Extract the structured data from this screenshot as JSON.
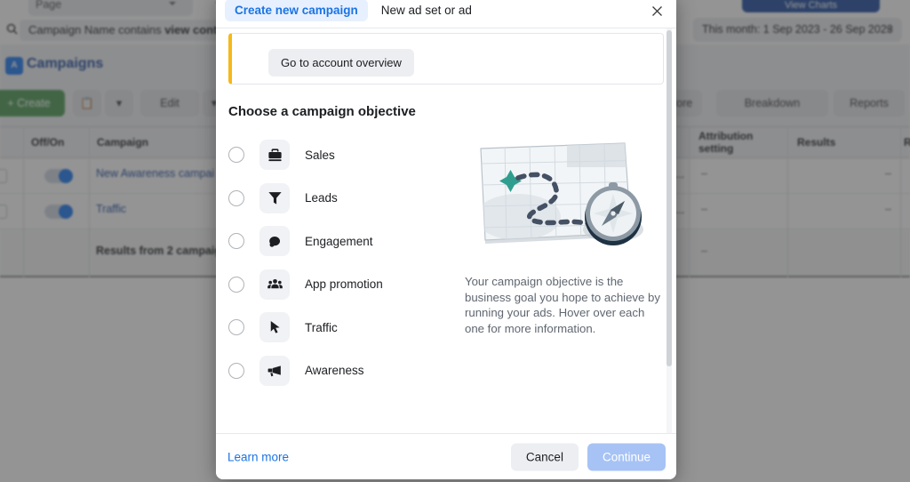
{
  "background": {
    "page_selector_label": "Page",
    "primary_button_label": "View Charts",
    "search": {
      "prefix": "Campaign Name contains ",
      "term": "view content"
    },
    "date_range": "This month: 1 Sep 2023 - 26 Sep 2023",
    "section_title": "Campaigns",
    "section_icon_letter": "A",
    "toolbar": {
      "create": "+  Create",
      "duplicate_icon": "duplicate-icon",
      "edit": "Edit",
      "more": "More",
      "breakdown": "Breakdown",
      "reports": "Reports"
    },
    "table": {
      "columns": [
        "Off/On",
        "Campaign",
        "Attribution setting",
        "Results",
        "R"
      ],
      "rows": [
        {
          "campaign": "New Awareness campai",
          "truncated": "l...",
          "attribution": "–",
          "results": "–",
          "toggle": "on"
        },
        {
          "campaign": "Traffic",
          "truncated": "l...",
          "attribution": "–",
          "results": "–",
          "toggle": "on"
        }
      ],
      "summary_label": "Results from 2 campaig",
      "summary_attribution": "–"
    }
  },
  "modal": {
    "tabs": [
      {
        "label": "Create new campaign",
        "active": true
      },
      {
        "label": "New ad set or ad",
        "active": false
      }
    ],
    "close_icon": "close-icon",
    "notice": {
      "button_label": "Go to account overview"
    },
    "section_title": "Choose a campaign objective",
    "objectives": [
      {
        "label": "Sales",
        "icon": "briefcase-icon",
        "selected": false
      },
      {
        "label": "Leads",
        "icon": "funnel-icon",
        "selected": false
      },
      {
        "label": "Engagement",
        "icon": "chat-bubbles-icon",
        "selected": false
      },
      {
        "label": "App promotion",
        "icon": "people-group-icon",
        "selected": false
      },
      {
        "label": "Traffic",
        "icon": "cursor-arrow-icon",
        "selected": false
      },
      {
        "label": "Awareness",
        "icon": "megaphone-icon",
        "selected": false
      }
    ],
    "aside": {
      "illustration": "map-with-compass-illustration",
      "description": "Your campaign objective is the business goal you hope to achieve by running your ads. Hover over each one for more information."
    },
    "footer": {
      "learn_more": "Learn more",
      "cancel": "Cancel",
      "continue": "Continue"
    }
  },
  "colors": {
    "accent_blue": "#1b74e4",
    "tab_active_bg": "#e7f0fe",
    "continue_disabled": "#a7c3f5",
    "notice_bar": "#f5b817",
    "create_green": "#4a9a51",
    "illustration_teal": "#2f9e8f"
  }
}
